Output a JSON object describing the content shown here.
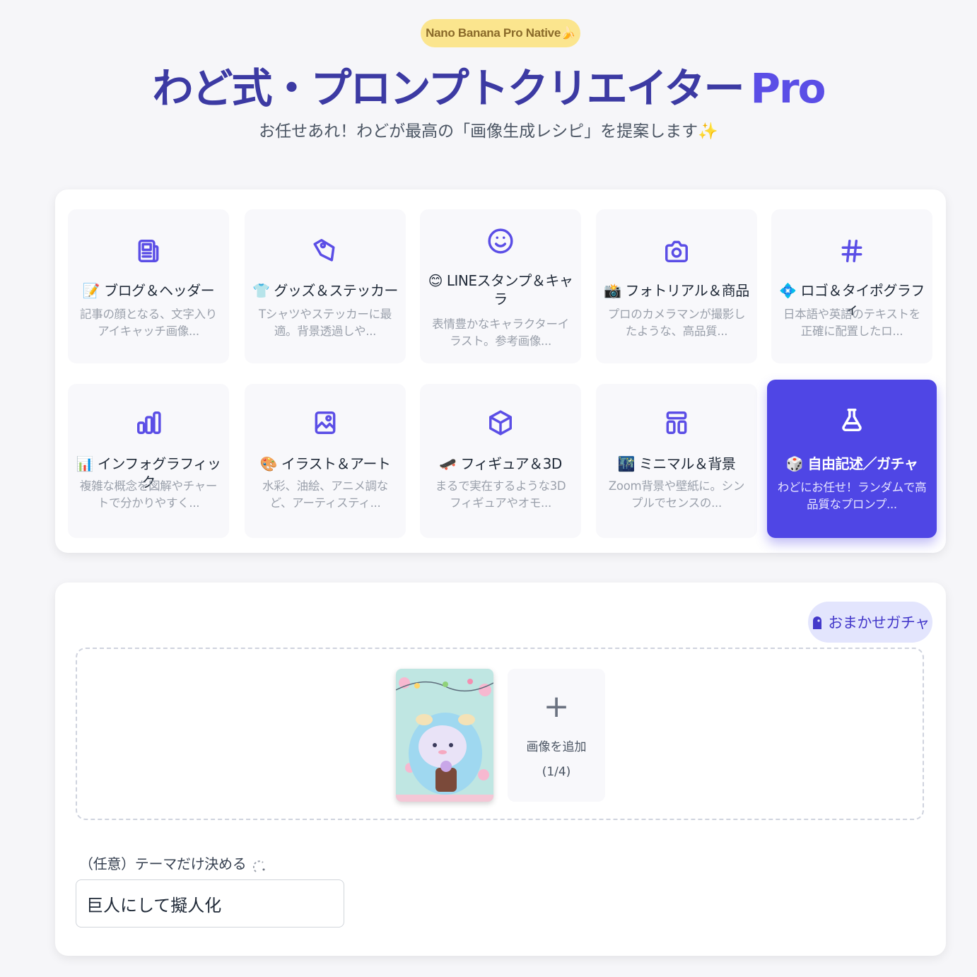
{
  "header": {
    "badge": "Nano Banana Pro Native🍌",
    "title": "わど式・プロンプトクリエイター",
    "title_suffix": "Pro",
    "subtitle": "お任せあれ！わどが最高の「画像生成レシピ」を提案します✨"
  },
  "categories": [
    {
      "icon": "document-icon",
      "name": "📝 ブログ＆ヘッダー",
      "desc": "記事の顔となる、文字入りアイキャッチ画像..."
    },
    {
      "icon": "tag-icon",
      "name": "👕 グッズ＆ステッカー",
      "desc": "Tシャツやステッカーに最適。背景透過しや..."
    },
    {
      "icon": "smile-icon",
      "name": "😊 LINEスタンプ＆キャラ",
      "desc": "表情豊かなキャラクターイラスト。参考画像..."
    },
    {
      "icon": "camera-icon",
      "name": "📸 フォトリアル＆商品",
      "desc": "プロのカメラマンが撮影したような、高品質..."
    },
    {
      "icon": "hash-icon",
      "name": "💠 ロゴ＆タイポグラフィ",
      "desc": "日本語や英語のテキストを正確に配置したロ..."
    },
    {
      "icon": "bar-chart-icon",
      "name": "📊 インフォグラフィック",
      "desc": "複雑な概念を図解やチャートで分かりやすく..."
    },
    {
      "icon": "image-icon",
      "name": "🎨 イラスト＆アート",
      "desc": "水彩、油絵、アニメ調など、アーティスティ..."
    },
    {
      "icon": "box-icon",
      "name": "🛹 フィギュア＆3D",
      "desc": "まるで実在するような3Dフィギュアやオモ..."
    },
    {
      "icon": "layout-icon",
      "name": "🌃 ミニマル＆背景",
      "desc": "Zoom背景や壁紙に。シンプルでセンスの..."
    },
    {
      "icon": "flask-icon",
      "name": "🎲 自由記述／ガチャ",
      "desc": "わどにお任せ！ランダムで高品質なプロンプ...",
      "active": true
    }
  ],
  "gacha_button": "おまかせガチャ",
  "upload": {
    "add_label": "画像を追加",
    "count": "(1/4)",
    "thumbnail_alt": "alpaca-character-image"
  },
  "theme": {
    "label": "（任意）テーマだけ決める",
    "value": "巨人にして擬人化"
  },
  "colors": {
    "accent": "#4f46e5",
    "title": "#3c3aa3",
    "badge": "#fbe58e"
  }
}
